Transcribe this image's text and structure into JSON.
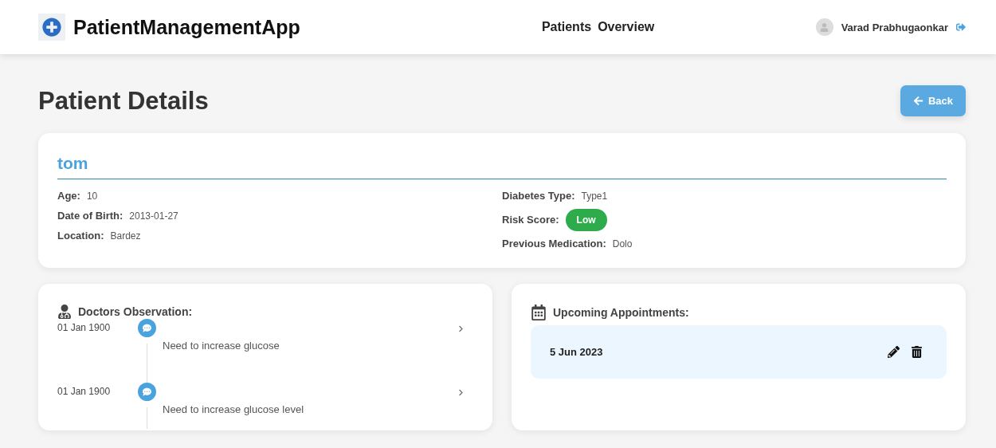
{
  "header": {
    "app_name": "PatientManagementApp",
    "nav": [
      "Patients",
      "Overview"
    ],
    "user": "Varad Prabhugaonkar"
  },
  "page_title": "Patient Details",
  "back_button": "Back",
  "patient": {
    "name": "tom",
    "fields_left": [
      {
        "label": "Age:",
        "value": "10"
      },
      {
        "label": "Date of Birth:",
        "value": "2013-01-27"
      },
      {
        "label": "Location:",
        "value": "Bardez"
      }
    ],
    "diabetes_type": {
      "label": "Diabetes Type:",
      "value": "Type1"
    },
    "risk_score": {
      "label": "Risk Score:",
      "value": "Low"
    },
    "previous_medication": {
      "label": "Previous Medication:",
      "value": "Dolo"
    }
  },
  "observations": {
    "title": "Doctors Observation:",
    "items": [
      {
        "date": "01 Jan 1900",
        "note": "Need to increase glucose"
      },
      {
        "date": "01 Jan 1900",
        "note": "Need to increase glucose level"
      }
    ]
  },
  "appointments": {
    "title": "Upcoming Appointments:",
    "items": [
      {
        "date": "5 Jun 2023"
      }
    ]
  }
}
